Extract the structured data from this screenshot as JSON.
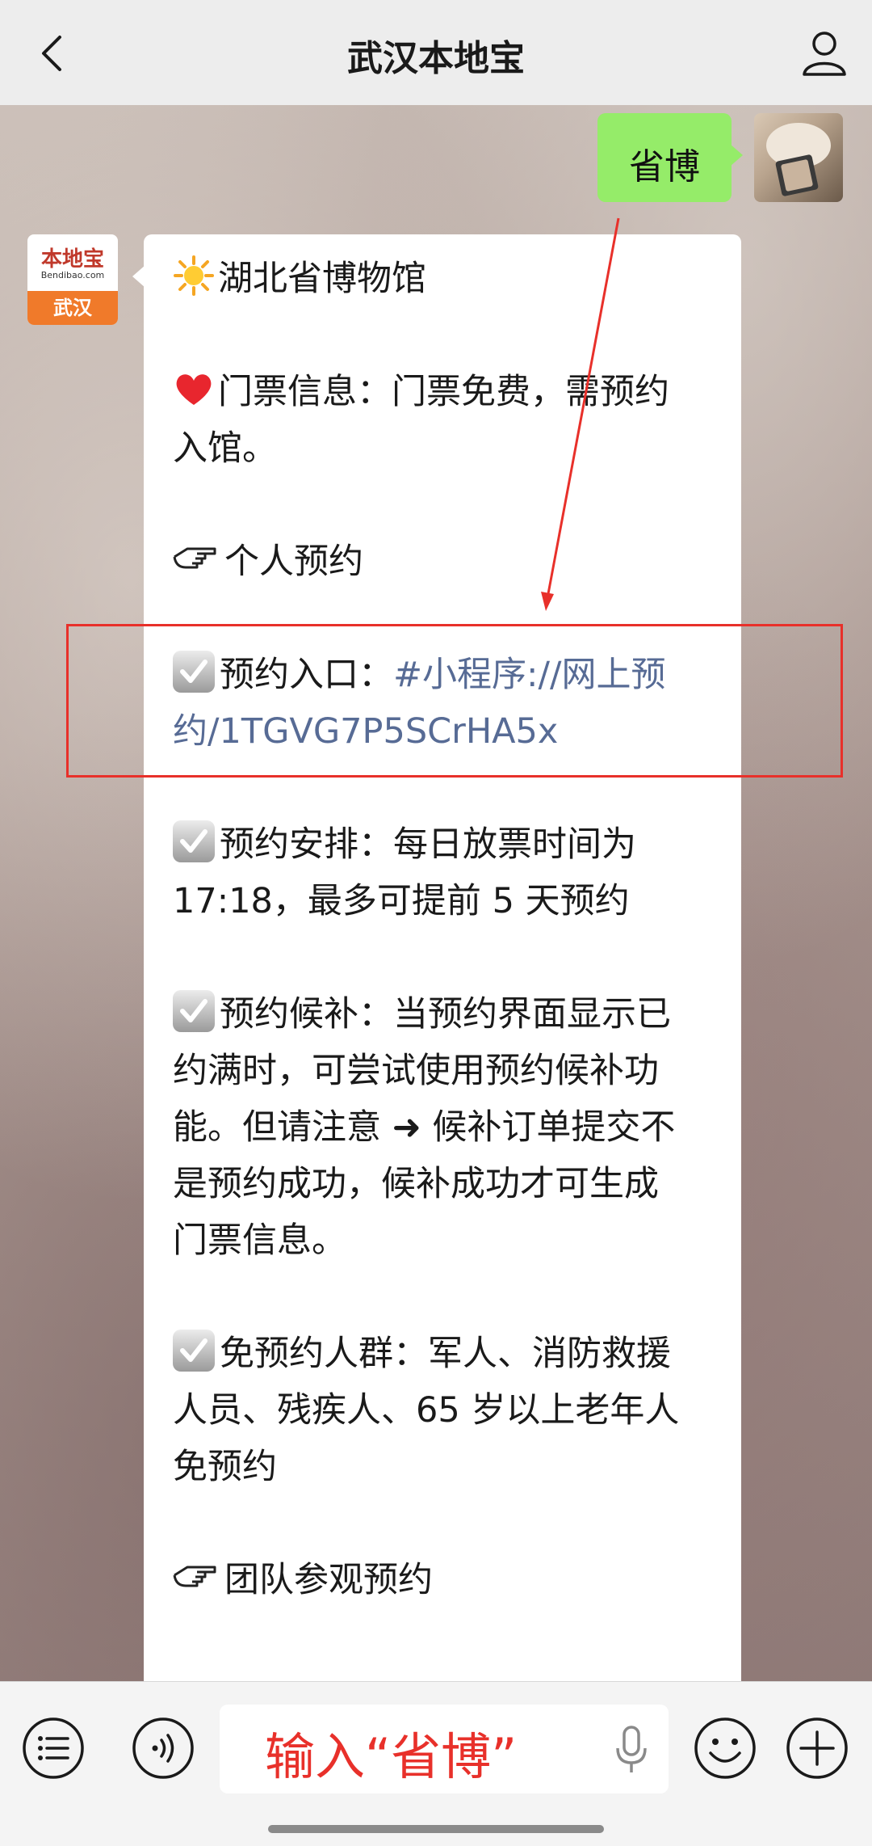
{
  "header": {
    "title": "武汉本地宝"
  },
  "chat": {
    "user_message": "省博",
    "sender_logo": {
      "name": "本地宝",
      "sub": "Bendibao.com",
      "city": "武汉"
    },
    "reply": {
      "title_line": "湖北省博物馆",
      "ticket_line1": "门票信息：门票免费，需预约",
      "ticket_line2": "入馆。",
      "personal_heading": "个人预约",
      "entry_label": "预约入口：",
      "entry_link1": "#小程序://网上预",
      "entry_link2": "约/1TGVG7P5SCrHA5x",
      "arrange_line1": "预约安排：每日放票时间为",
      "arrange_line2": "17:18，最多可提前 5 天预约",
      "waitlist_line1": "预约候补：当预约界面显示已",
      "waitlist_line2": "约满时，可尝试使用预约候补功",
      "waitlist_line3": "能。但请注意 ➜ 候补订单提交不",
      "waitlist_line4": "是预约成功，候补成功才可生成",
      "waitlist_line5": "门票信息。",
      "exempt_line1": "免预约人群：军人、消防救援",
      "exempt_line2": "人员、残疾人、65 岁以上老年人",
      "exempt_line3": "免预约",
      "group_heading": "团队参观预约"
    }
  },
  "input": {
    "hint": "输入“省博”"
  },
  "colors": {
    "bubble_green": "#95ec69",
    "link": "#576b95",
    "annotation_red": "#e8302a"
  },
  "icons": [
    "back-arrow-icon",
    "profile-icon",
    "menu-list-icon",
    "voice-icon",
    "microphone-icon",
    "emoji-icon",
    "plus-icon",
    "checkmark-icon",
    "sun-icon",
    "heart-icon",
    "pointing-hand-icon"
  ]
}
